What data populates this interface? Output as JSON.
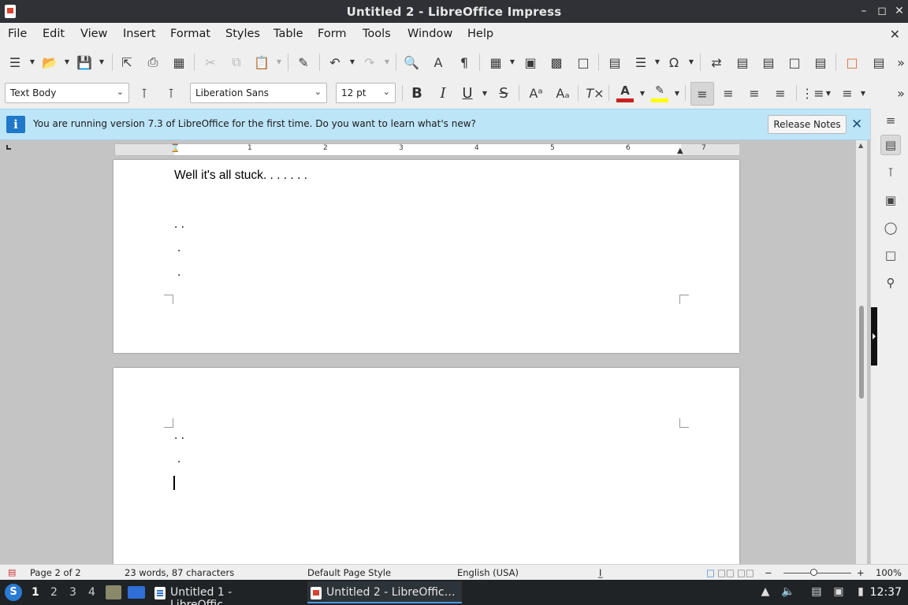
{
  "window": {
    "title": "Untitled 2 - LibreOffice Impress",
    "controls": {
      "minimize": "–",
      "maximize": "◻",
      "close": "✕"
    }
  },
  "menu": {
    "items": [
      "File",
      "Edit",
      "View",
      "Insert",
      "Format",
      "Styles",
      "Table",
      "Form",
      "Tools",
      "Window",
      "Help"
    ],
    "close_doc": "✕"
  },
  "formatting": {
    "paragraph_style": "Text Body",
    "font_name": "Liberation Sans",
    "font_size": "12 pt",
    "bold": "B",
    "italic": "I",
    "underline": "U",
    "strike": "S",
    "font_color": "#c9211e",
    "highlight_color": "#ffff00"
  },
  "infobar": {
    "message": "You are running version 7.3 of LibreOffice for the first time. Do you want to learn what's new?",
    "button": "Release Notes",
    "icon": "i"
  },
  "ruler": {
    "numbers": [
      "1",
      "2",
      "3",
      "4",
      "5",
      "6",
      "7"
    ]
  },
  "document": {
    "page1_lines": [
      "Well it's all stuck. . . . . . .",
      ". .",
      ".",
      "."
    ],
    "page2_lines": [
      ". .",
      "."
    ]
  },
  "status": {
    "page": "Page 2 of 2",
    "words": "23 words, 87 characters",
    "page_style": "Default Page Style",
    "language": "English (USA)",
    "zoom_minus": "−",
    "zoom_plus": "+",
    "zoom": "100%",
    "zoom_level": 1.0
  },
  "taskbar": {
    "workspaces": [
      "1",
      "2",
      "3",
      "4"
    ],
    "tasks": [
      "Untitled 1 - LibreOffic…",
      "Untitled 2 - LibreOffic…"
    ],
    "clock": "12:37"
  },
  "icons": {
    "sidebar": [
      "properties-icon",
      "styles-icon",
      "gallery-icon",
      "navigator-icon",
      "page-icon",
      "find-icon"
    ]
  }
}
